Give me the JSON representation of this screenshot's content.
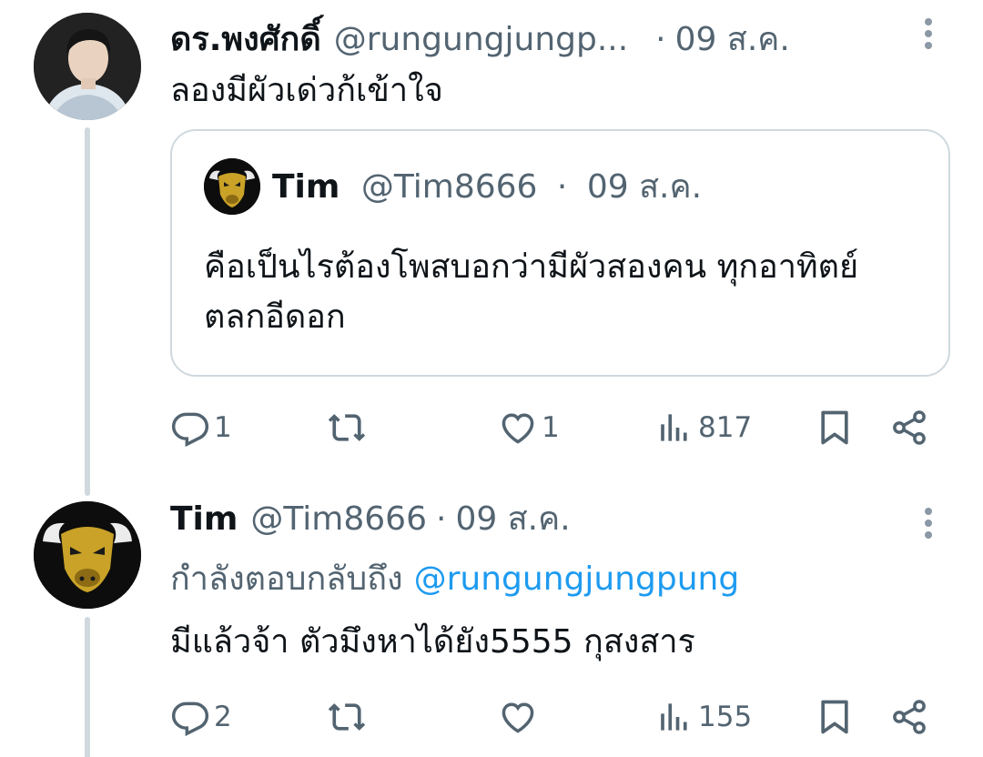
{
  "tweet1": {
    "name": "ดร.พงศักดิ์",
    "handle": "@rungungjungp...",
    "dot": "·",
    "date": "09 ส.ค.",
    "text": "ลองมีผัวเด่วก้เข้าใจ",
    "quote": {
      "name": "Tim",
      "handle": "@Tim8666",
      "dot": "·",
      "date": "09 ส.ค.",
      "text": "คือเป็นไรต้องโพสบอกว่ามีผัวสองคน ทุกอาทิตย์ ตลกอีดอก"
    },
    "actions": {
      "replies": "1",
      "likes": "1",
      "views": "817"
    }
  },
  "tweet2": {
    "name": "Tim",
    "handle": "@Tim8666",
    "dot": "·",
    "date": "09 ส.ค.",
    "reply_prefix": "กำลังตอบกลับถึง",
    "reply_mention": "@rungungjungpung",
    "text": "มีแล้วจ้า ตัวมึงหาได้ยัง5555 กุสงสาร",
    "actions": {
      "replies": "2",
      "views": "155"
    }
  },
  "colors": {
    "text": "#0f1419",
    "secondary": "#536471",
    "link": "#1d9bf0",
    "border": "#cfd9de"
  },
  "icons": [
    "more-icon",
    "reply-icon",
    "retweet-icon",
    "like-icon",
    "views-icon",
    "bookmark-icon",
    "share-icon",
    "bull-logo-avatar"
  ]
}
